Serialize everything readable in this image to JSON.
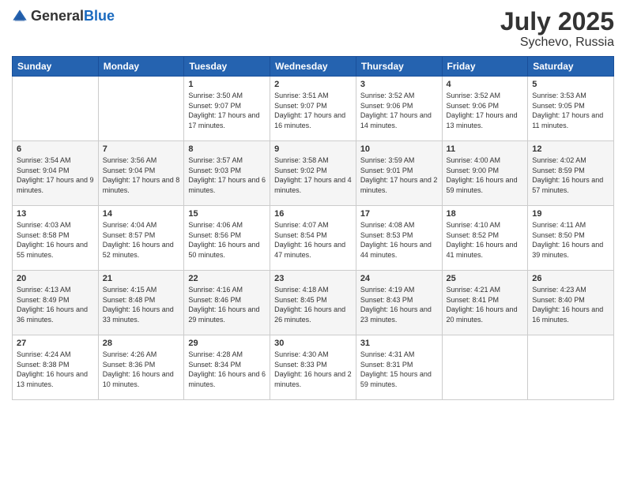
{
  "header": {
    "logo_general": "General",
    "logo_blue": "Blue",
    "month": "July 2025",
    "location": "Sychevo, Russia"
  },
  "weekdays": [
    "Sunday",
    "Monday",
    "Tuesday",
    "Wednesday",
    "Thursday",
    "Friday",
    "Saturday"
  ],
  "weeks": [
    [
      {
        "day": "",
        "info": ""
      },
      {
        "day": "",
        "info": ""
      },
      {
        "day": "1",
        "info": "Sunrise: 3:50 AM\nSunset: 9:07 PM\nDaylight: 17 hours and 17 minutes."
      },
      {
        "day": "2",
        "info": "Sunrise: 3:51 AM\nSunset: 9:07 PM\nDaylight: 17 hours and 16 minutes."
      },
      {
        "day": "3",
        "info": "Sunrise: 3:52 AM\nSunset: 9:06 PM\nDaylight: 17 hours and 14 minutes."
      },
      {
        "day": "4",
        "info": "Sunrise: 3:52 AM\nSunset: 9:06 PM\nDaylight: 17 hours and 13 minutes."
      },
      {
        "day": "5",
        "info": "Sunrise: 3:53 AM\nSunset: 9:05 PM\nDaylight: 17 hours and 11 minutes."
      }
    ],
    [
      {
        "day": "6",
        "info": "Sunrise: 3:54 AM\nSunset: 9:04 PM\nDaylight: 17 hours and 9 minutes."
      },
      {
        "day": "7",
        "info": "Sunrise: 3:56 AM\nSunset: 9:04 PM\nDaylight: 17 hours and 8 minutes."
      },
      {
        "day": "8",
        "info": "Sunrise: 3:57 AM\nSunset: 9:03 PM\nDaylight: 17 hours and 6 minutes."
      },
      {
        "day": "9",
        "info": "Sunrise: 3:58 AM\nSunset: 9:02 PM\nDaylight: 17 hours and 4 minutes."
      },
      {
        "day": "10",
        "info": "Sunrise: 3:59 AM\nSunset: 9:01 PM\nDaylight: 17 hours and 2 minutes."
      },
      {
        "day": "11",
        "info": "Sunrise: 4:00 AM\nSunset: 9:00 PM\nDaylight: 16 hours and 59 minutes."
      },
      {
        "day": "12",
        "info": "Sunrise: 4:02 AM\nSunset: 8:59 PM\nDaylight: 16 hours and 57 minutes."
      }
    ],
    [
      {
        "day": "13",
        "info": "Sunrise: 4:03 AM\nSunset: 8:58 PM\nDaylight: 16 hours and 55 minutes."
      },
      {
        "day": "14",
        "info": "Sunrise: 4:04 AM\nSunset: 8:57 PM\nDaylight: 16 hours and 52 minutes."
      },
      {
        "day": "15",
        "info": "Sunrise: 4:06 AM\nSunset: 8:56 PM\nDaylight: 16 hours and 50 minutes."
      },
      {
        "day": "16",
        "info": "Sunrise: 4:07 AM\nSunset: 8:54 PM\nDaylight: 16 hours and 47 minutes."
      },
      {
        "day": "17",
        "info": "Sunrise: 4:08 AM\nSunset: 8:53 PM\nDaylight: 16 hours and 44 minutes."
      },
      {
        "day": "18",
        "info": "Sunrise: 4:10 AM\nSunset: 8:52 PM\nDaylight: 16 hours and 41 minutes."
      },
      {
        "day": "19",
        "info": "Sunrise: 4:11 AM\nSunset: 8:50 PM\nDaylight: 16 hours and 39 minutes."
      }
    ],
    [
      {
        "day": "20",
        "info": "Sunrise: 4:13 AM\nSunset: 8:49 PM\nDaylight: 16 hours and 36 minutes."
      },
      {
        "day": "21",
        "info": "Sunrise: 4:15 AM\nSunset: 8:48 PM\nDaylight: 16 hours and 33 minutes."
      },
      {
        "day": "22",
        "info": "Sunrise: 4:16 AM\nSunset: 8:46 PM\nDaylight: 16 hours and 29 minutes."
      },
      {
        "day": "23",
        "info": "Sunrise: 4:18 AM\nSunset: 8:45 PM\nDaylight: 16 hours and 26 minutes."
      },
      {
        "day": "24",
        "info": "Sunrise: 4:19 AM\nSunset: 8:43 PM\nDaylight: 16 hours and 23 minutes."
      },
      {
        "day": "25",
        "info": "Sunrise: 4:21 AM\nSunset: 8:41 PM\nDaylight: 16 hours and 20 minutes."
      },
      {
        "day": "26",
        "info": "Sunrise: 4:23 AM\nSunset: 8:40 PM\nDaylight: 16 hours and 16 minutes."
      }
    ],
    [
      {
        "day": "27",
        "info": "Sunrise: 4:24 AM\nSunset: 8:38 PM\nDaylight: 16 hours and 13 minutes."
      },
      {
        "day": "28",
        "info": "Sunrise: 4:26 AM\nSunset: 8:36 PM\nDaylight: 16 hours and 10 minutes."
      },
      {
        "day": "29",
        "info": "Sunrise: 4:28 AM\nSunset: 8:34 PM\nDaylight: 16 hours and 6 minutes."
      },
      {
        "day": "30",
        "info": "Sunrise: 4:30 AM\nSunset: 8:33 PM\nDaylight: 16 hours and 2 minutes."
      },
      {
        "day": "31",
        "info": "Sunrise: 4:31 AM\nSunset: 8:31 PM\nDaylight: 15 hours and 59 minutes."
      },
      {
        "day": "",
        "info": ""
      },
      {
        "day": "",
        "info": ""
      }
    ]
  ]
}
